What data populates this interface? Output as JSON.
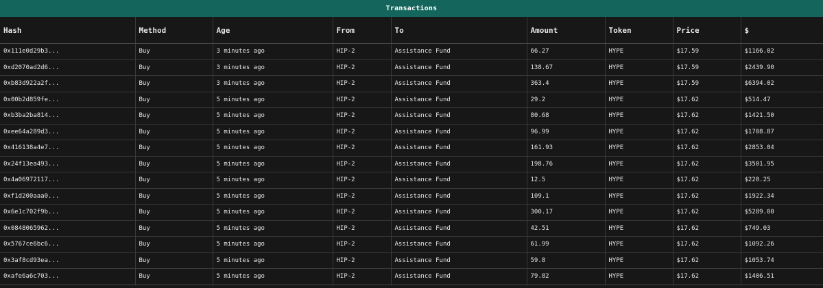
{
  "window": {
    "title": "Transactions"
  },
  "table": {
    "columns": [
      "Hash",
      "Method",
      "Age",
      "From",
      "To",
      "Amount",
      "Token",
      "Price",
      "$"
    ],
    "rows": [
      [
        "0x111e0d29b3...",
        "Buy",
        "3 minutes ago",
        "HIP-2",
        "Assistance Fund",
        "66.27",
        "HYPE",
        "$17.59",
        "$1166.02"
      ],
      [
        "0xd2070ad2d6...",
        "Buy",
        "3 minutes ago",
        "HIP-2",
        "Assistance Fund",
        "138.67",
        "HYPE",
        "$17.59",
        "$2439.90"
      ],
      [
        "0xb83d922a2f...",
        "Buy",
        "3 minutes ago",
        "HIP-2",
        "Assistance Fund",
        "363.4",
        "HYPE",
        "$17.59",
        "$6394.02"
      ],
      [
        "0x00b2d859fe...",
        "Buy",
        "5 minutes ago",
        "HIP-2",
        "Assistance Fund",
        "29.2",
        "HYPE",
        "$17.62",
        "$514.47"
      ],
      [
        "0xb3ba2ba814...",
        "Buy",
        "5 minutes ago",
        "HIP-2",
        "Assistance Fund",
        "80.68",
        "HYPE",
        "$17.62",
        "$1421.50"
      ],
      [
        "0xee64a289d3...",
        "Buy",
        "5 minutes ago",
        "HIP-2",
        "Assistance Fund",
        "96.99",
        "HYPE",
        "$17.62",
        "$1708.87"
      ],
      [
        "0x416138a4e7...",
        "Buy",
        "5 minutes ago",
        "HIP-2",
        "Assistance Fund",
        "161.93",
        "HYPE",
        "$17.62",
        "$2853.04"
      ],
      [
        "0x24f13ea493...",
        "Buy",
        "5 minutes ago",
        "HIP-2",
        "Assistance Fund",
        "198.76",
        "HYPE",
        "$17.62",
        "$3501.95"
      ],
      [
        "0x4a06972117...",
        "Buy",
        "5 minutes ago",
        "HIP-2",
        "Assistance Fund",
        "12.5",
        "HYPE",
        "$17.62",
        "$220.25"
      ],
      [
        "0xf1d200aaa0...",
        "Buy",
        "5 minutes ago",
        "HIP-2",
        "Assistance Fund",
        "109.1",
        "HYPE",
        "$17.62",
        "$1922.34"
      ],
      [
        "0x6e1c702f9b...",
        "Buy",
        "5 minutes ago",
        "HIP-2",
        "Assistance Fund",
        "300.17",
        "HYPE",
        "$17.62",
        "$5289.00"
      ],
      [
        "0x0848065962...",
        "Buy",
        "5 minutes ago",
        "HIP-2",
        "Assistance Fund",
        "42.51",
        "HYPE",
        "$17.62",
        "$749.03"
      ],
      [
        "0x5767ce6bc6...",
        "Buy",
        "5 minutes ago",
        "HIP-2",
        "Assistance Fund",
        "61.99",
        "HYPE",
        "$17.62",
        "$1092.26"
      ],
      [
        "0x3af8cd93ea...",
        "Buy",
        "5 minutes ago",
        "HIP-2",
        "Assistance Fund",
        "59.8",
        "HYPE",
        "$17.62",
        "$1053.74"
      ],
      [
        "0xafe6a6c703...",
        "Buy",
        "5 minutes ago",
        "HIP-2",
        "Assistance Fund",
        "79.82",
        "HYPE",
        "$17.62",
        "$1406.51"
      ]
    ]
  },
  "colors": {
    "titlebar": "#14655b",
    "background": "#171717",
    "text": "#e6e6e6",
    "grid": "#3a3a3a"
  }
}
